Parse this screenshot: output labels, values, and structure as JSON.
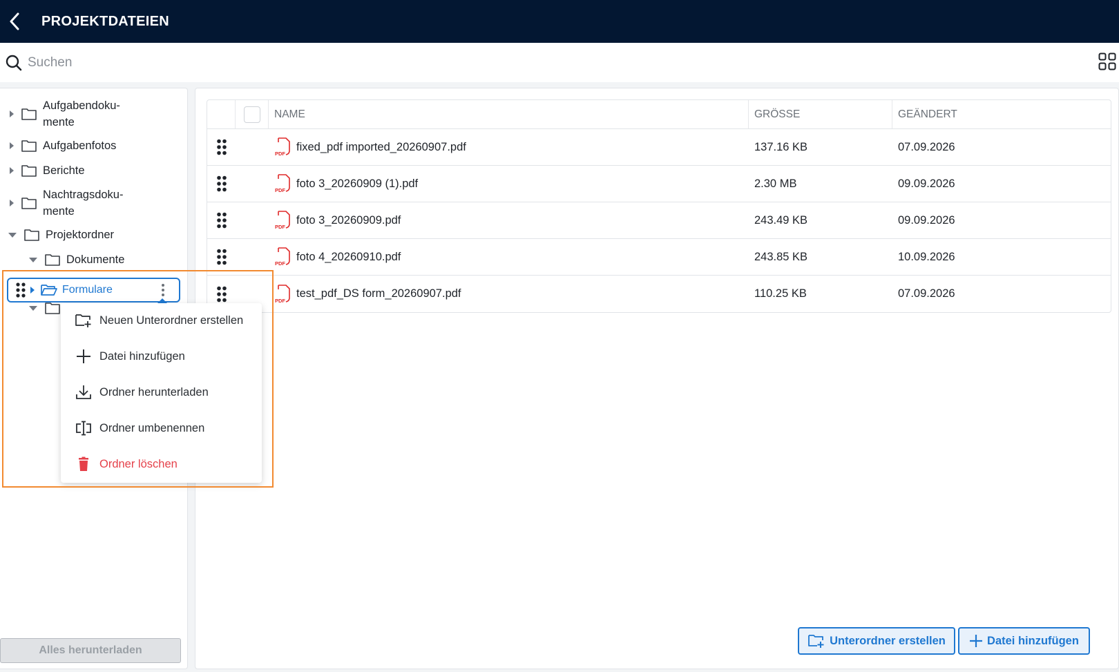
{
  "header": {
    "title": "PROJEKTDATEIEN",
    "back_icon": "chevron-left-icon"
  },
  "search": {
    "placeholder": "Suchen"
  },
  "tree": {
    "items": [
      {
        "label_lines": [
          "Aufgabendoku-",
          "mente"
        ],
        "expanded": false,
        "level": 0
      },
      {
        "label": "Aufgabenfotos",
        "expanded": false,
        "level": 0
      },
      {
        "label": "Berichte",
        "expanded": false,
        "level": 0
      },
      {
        "label_lines": [
          "Nachtragsdoku-",
          "mente"
        ],
        "expanded": false,
        "level": 0
      },
      {
        "label": "Projektordner",
        "expanded": true,
        "level": 0
      },
      {
        "label": "Dokumente",
        "expanded": true,
        "level": 1
      },
      {
        "label": "Formulare",
        "expanded": false,
        "level": 1,
        "selected": true
      },
      {
        "label": "",
        "expanded": true,
        "level": 1
      }
    ],
    "download_all": "Alles herunterladen"
  },
  "table": {
    "columns": {
      "name": "NAME",
      "size": "GRÖSSE",
      "date": "GEÄNDERT"
    },
    "rows": [
      {
        "name": "fixed_pdf imported_20260907.pdf",
        "size": "137.16 KB",
        "date": "07.09.2026"
      },
      {
        "name": "foto 3_20260909 (1).pdf",
        "size": "2.30 MB",
        "date": "09.09.2026"
      },
      {
        "name": "foto 3_20260909.pdf",
        "size": "243.49 KB",
        "date": "09.09.2026"
      },
      {
        "name": "foto 4_20260910.pdf",
        "size": "243.85 KB",
        "date": "10.09.2026"
      },
      {
        "name": "test_pdf_DS form_20260907.pdf",
        "size": "110.25 KB",
        "date": "07.09.2026"
      }
    ]
  },
  "context_menu": {
    "items": [
      {
        "label": "Neuen Unterordner erstellen",
        "icon": "folder-plus-icon"
      },
      {
        "label": "Datei hinzufügen",
        "icon": "plus-icon"
      },
      {
        "label": "Ordner herunterladen",
        "icon": "download-icon"
      },
      {
        "label": "Ordner umbenennen",
        "icon": "rename-icon"
      },
      {
        "label": "Ordner löschen",
        "icon": "trash-icon"
      }
    ]
  },
  "actions": {
    "create_subfolder": "Unterordner erstellen",
    "add_file": "Datei hinzufügen"
  },
  "colors": {
    "header_bg": "#031732",
    "accent": "#1f78d1",
    "danger": "#e5414a",
    "highlight": "#f28a30",
    "pdf_red": "#e02a2a"
  }
}
